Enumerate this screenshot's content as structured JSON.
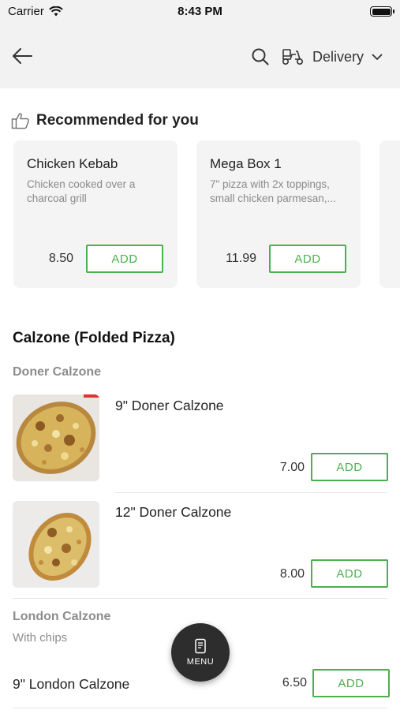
{
  "status_bar": {
    "carrier": "Carrier",
    "time": "8:43 PM"
  },
  "nav": {
    "back_icon": "arrow-left-icon",
    "search_icon": "search-icon",
    "scooter_icon": "scooter-icon",
    "delivery_label": "Delivery",
    "chevron_icon": "chevron-down-icon"
  },
  "recommended": {
    "title": "Recommended for you",
    "icon": "thumbs-up-icon",
    "items": [
      {
        "name": "Chicken Kebab",
        "description": "Chicken cooked over a charcoal grill",
        "price": "8.50",
        "add_label": "ADD"
      },
      {
        "name": "Mega Box 1",
        "description": "7\" pizza with 2x toppings, small chicken parmesan,...",
        "price": "11.99",
        "add_label": "ADD"
      }
    ]
  },
  "menu_section": {
    "title": "Calzone (Folded Pizza)",
    "categories": [
      {
        "title": "Doner Calzone",
        "items": [
          {
            "name": "9\" Doner Calzone",
            "price": "7.00",
            "add_label": "ADD"
          },
          {
            "name": "12\" Doner Calzone",
            "price": "8.00",
            "add_label": "ADD"
          }
        ]
      },
      {
        "title": "London Calzone",
        "subtitle": "With chips",
        "items": [
          {
            "name": "9\" London Calzone",
            "price": "6.50",
            "add_label": "ADD"
          }
        ]
      }
    ]
  },
  "fab": {
    "label": "MENU",
    "icon": "menu-book-icon"
  },
  "colors": {
    "accent": "#4caf50",
    "header_bg": "#f2f2f2",
    "card_bg": "#f4f4f4",
    "fab_bg": "#2d2d2d"
  }
}
